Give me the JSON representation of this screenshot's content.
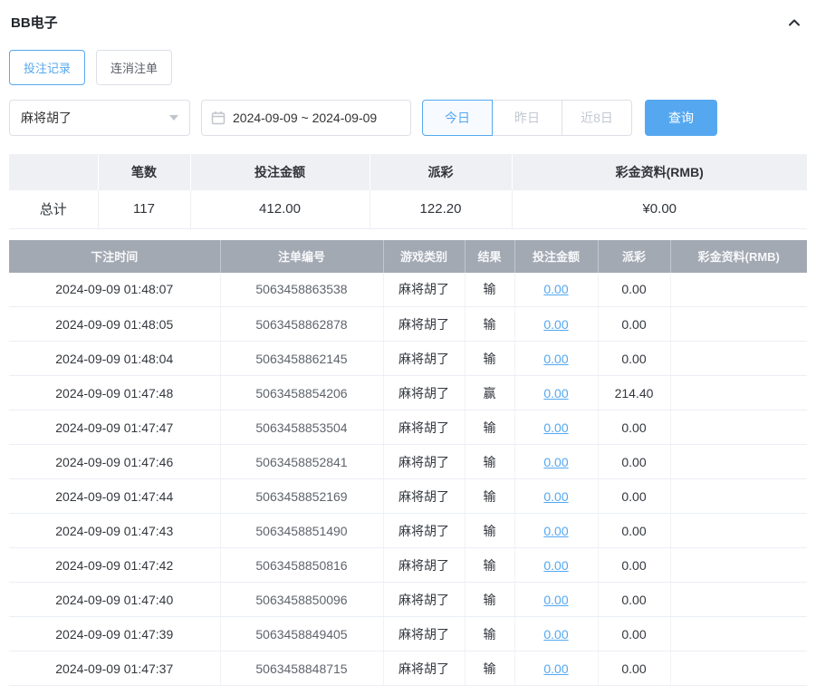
{
  "panel": {
    "title": "BB电子"
  },
  "tabs": [
    {
      "label": "投注记录",
      "active": true
    },
    {
      "label": "连消注单",
      "active": false
    }
  ],
  "filters": {
    "game_select": {
      "value": "麻将胡了"
    },
    "date_range": {
      "value": "2024-09-09 ~ 2024-09-09"
    },
    "quick": [
      {
        "label": "今日",
        "active": true
      },
      {
        "label": "昨日",
        "active": false
      },
      {
        "label": "近8日",
        "active": false
      }
    ],
    "search_label": "查询"
  },
  "summary": {
    "headers": [
      "",
      "笔数",
      "投注金额",
      "派彩",
      "彩金资料(RMB)"
    ],
    "row": {
      "label": "总计",
      "count": "117",
      "bet_amount": "412.00",
      "payout": "122.20",
      "bonus": "¥0.00"
    }
  },
  "table": {
    "headers": [
      "下注时间",
      "注单编号",
      "游戏类别",
      "结果",
      "投注金额",
      "派彩",
      "彩金资料(RMB)"
    ],
    "column_keys": [
      "time",
      "order-id",
      "game-type",
      "result",
      "bet-amount",
      "payout",
      "bonus"
    ],
    "rows": [
      [
        "2024-09-09 01:48:07",
        "5063458863538",
        "麻将胡了",
        "输",
        "0.00",
        "0.00",
        ""
      ],
      [
        "2024-09-09 01:48:05",
        "5063458862878",
        "麻将胡了",
        "输",
        "0.00",
        "0.00",
        ""
      ],
      [
        "2024-09-09 01:48:04",
        "5063458862145",
        "麻将胡了",
        "输",
        "0.00",
        "0.00",
        ""
      ],
      [
        "2024-09-09 01:47:48",
        "5063458854206",
        "麻将胡了",
        "赢",
        "0.00",
        "214.40",
        ""
      ],
      [
        "2024-09-09 01:47:47",
        "5063458853504",
        "麻将胡了",
        "输",
        "0.00",
        "0.00",
        ""
      ],
      [
        "2024-09-09 01:47:46",
        "5063458852841",
        "麻将胡了",
        "输",
        "0.00",
        "0.00",
        ""
      ],
      [
        "2024-09-09 01:47:44",
        "5063458852169",
        "麻将胡了",
        "输",
        "0.00",
        "0.00",
        ""
      ],
      [
        "2024-09-09 01:47:43",
        "5063458851490",
        "麻将胡了",
        "输",
        "0.00",
        "0.00",
        ""
      ],
      [
        "2024-09-09 01:47:42",
        "5063458850816",
        "麻将胡了",
        "输",
        "0.00",
        "0.00",
        ""
      ],
      [
        "2024-09-09 01:47:40",
        "5063458850096",
        "麻将胡了",
        "输",
        "0.00",
        "0.00",
        ""
      ],
      [
        "2024-09-09 01:47:39",
        "5063458849405",
        "麻将胡了",
        "输",
        "0.00",
        "0.00",
        ""
      ],
      [
        "2024-09-09 01:47:37",
        "5063458848715",
        "麻将胡了",
        "输",
        "0.00",
        "0.00",
        ""
      ]
    ]
  },
  "colors": {
    "accent": "#55a8f0",
    "table_header_bg": "#a3a9b3",
    "summary_header_bg": "#eef0f3"
  }
}
